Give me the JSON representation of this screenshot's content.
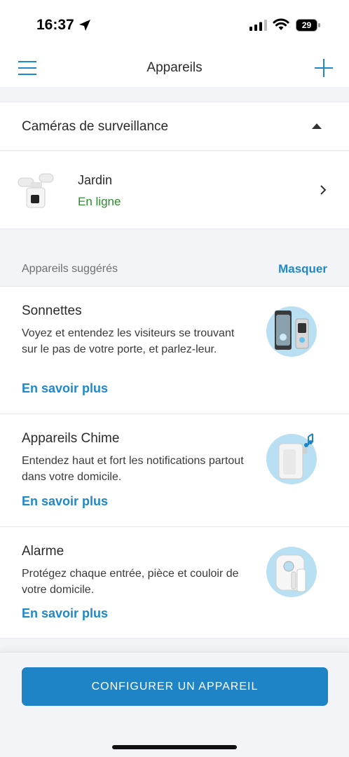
{
  "status_bar": {
    "time": "16:37",
    "battery": "29"
  },
  "nav": {
    "title": "Appareils",
    "menu_icon": "hamburger-menu-icon",
    "add_icon": "plus-icon"
  },
  "cameras": {
    "header": "Caméras de surveillance",
    "devices": [
      {
        "name": "Jardin",
        "status": "En ligne"
      }
    ]
  },
  "suggested": {
    "header": "Appareils suggérés",
    "hide_label": "Masquer",
    "cards": [
      {
        "title": "Sonnettes",
        "desc": "Voyez et entendez les visiteurs se trouvant sur le pas de votre porte, et parlez-leur.",
        "link": "En savoir plus",
        "icon": "doorbell-icon"
      },
      {
        "title": "Appareils Chime",
        "desc": "Entendez haut et fort les notifications partout dans votre domicile.",
        "link": "En savoir plus",
        "icon": "chime-icon"
      },
      {
        "title": "Alarme",
        "desc": "Protégez chaque entrée, pièce et couloir de votre domicile.",
        "link": "En savoir plus",
        "icon": "alarm-icon"
      }
    ]
  },
  "footer": {
    "button_label": "CONFIGURER UN APPAREIL"
  },
  "colors": {
    "accent": "#1f88c9",
    "button": "#1f84c6",
    "online": "#2e8b2e",
    "illustration_bg": "#b9dff2"
  }
}
